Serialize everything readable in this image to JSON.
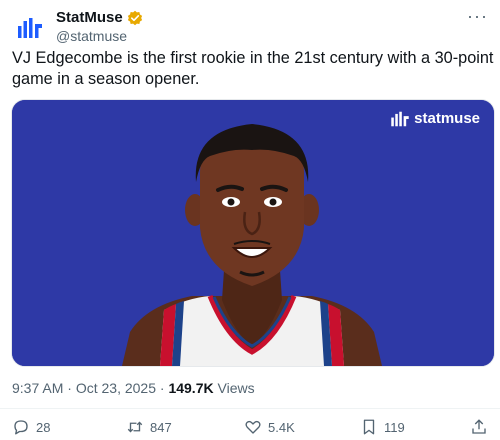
{
  "author": {
    "display_name": "StatMuse",
    "handle": "@statmuse",
    "verified_icon": "verified-badge-icon",
    "avatar_icon": "statmuse-logo-icon"
  },
  "more_label": "···",
  "tweet": {
    "text": "VJ Edgecombe is the first rookie in the 21st century with a 30-point game in a season opener."
  },
  "media": {
    "watermark": "statmuse",
    "background_color": "#2e39a6"
  },
  "meta": {
    "time": "9:37 AM",
    "separator": "·",
    "date": "Oct 23, 2025",
    "views_count": "149.7K",
    "views_label": "Views"
  },
  "actions": {
    "replies": "28",
    "reposts": "847",
    "likes": "5.4K",
    "bookmarks": "119"
  },
  "colors": {
    "text": "#0f1419",
    "secondary": "#536471",
    "verified": "#e8a900",
    "brand": "#2e39a6"
  }
}
